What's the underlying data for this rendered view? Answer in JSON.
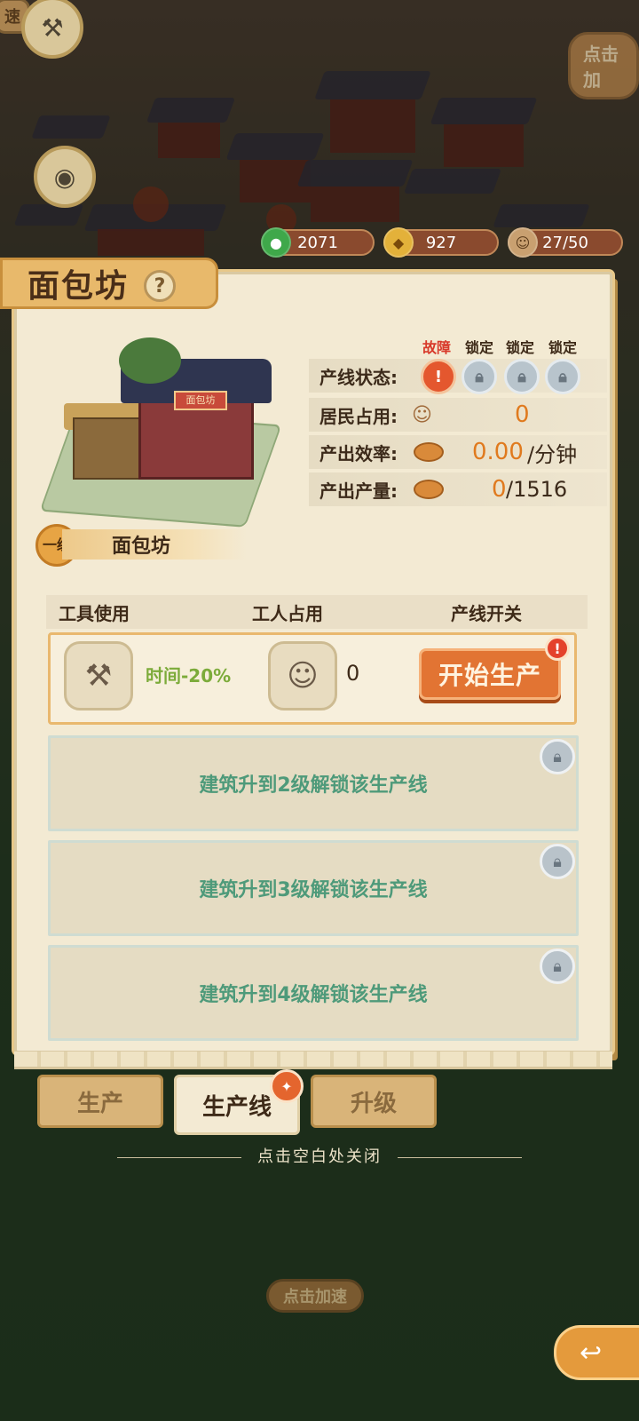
{
  "resources": [
    {
      "icon": "jade-coin-icon",
      "value": "2071"
    },
    {
      "icon": "copper-coin-icon",
      "value": "927"
    },
    {
      "icon": "worker-icon",
      "value": "27/50"
    }
  ],
  "map_hints": {
    "top_right": "点击加",
    "top_left": "速",
    "speed_up": "点击加速"
  },
  "building": {
    "title": "面包坊",
    "level_label": "一级",
    "name": "面包坊",
    "sign_text": "面包坊"
  },
  "line_status_labels": [
    "故障",
    "锁定",
    "锁定",
    "锁定"
  ],
  "line_status_fault_mark": "!",
  "stats": {
    "line_status_label": "产线状态:",
    "residents_label": "居民占用:",
    "residents_value": "0",
    "efficiency_label": "产出效率:",
    "efficiency_value": "0.00",
    "efficiency_unit": "/分钟",
    "output_label": "产出产量:",
    "output_current": "0",
    "output_total": "/1516"
  },
  "production": {
    "headers": [
      "工具使用",
      "工人占用",
      "产线开关"
    ],
    "tool_bonus": "时间-20%",
    "worker_count": "0",
    "start_button": "开始生产",
    "alert": "!",
    "locked_lines": [
      "建筑升到2级解锁该生产线",
      "建筑升到3级解锁该生产线",
      "建筑升到4级解锁该生产线"
    ]
  },
  "tabs": [
    "生产",
    "生产线",
    "升级"
  ],
  "close_hint": "点击空白处关闭",
  "colors": {
    "accent_orange": "#e27433",
    "fault_red": "#e4572e",
    "locked_text_green": "#4e9a7a",
    "panel_bg": "#f3ead3"
  }
}
